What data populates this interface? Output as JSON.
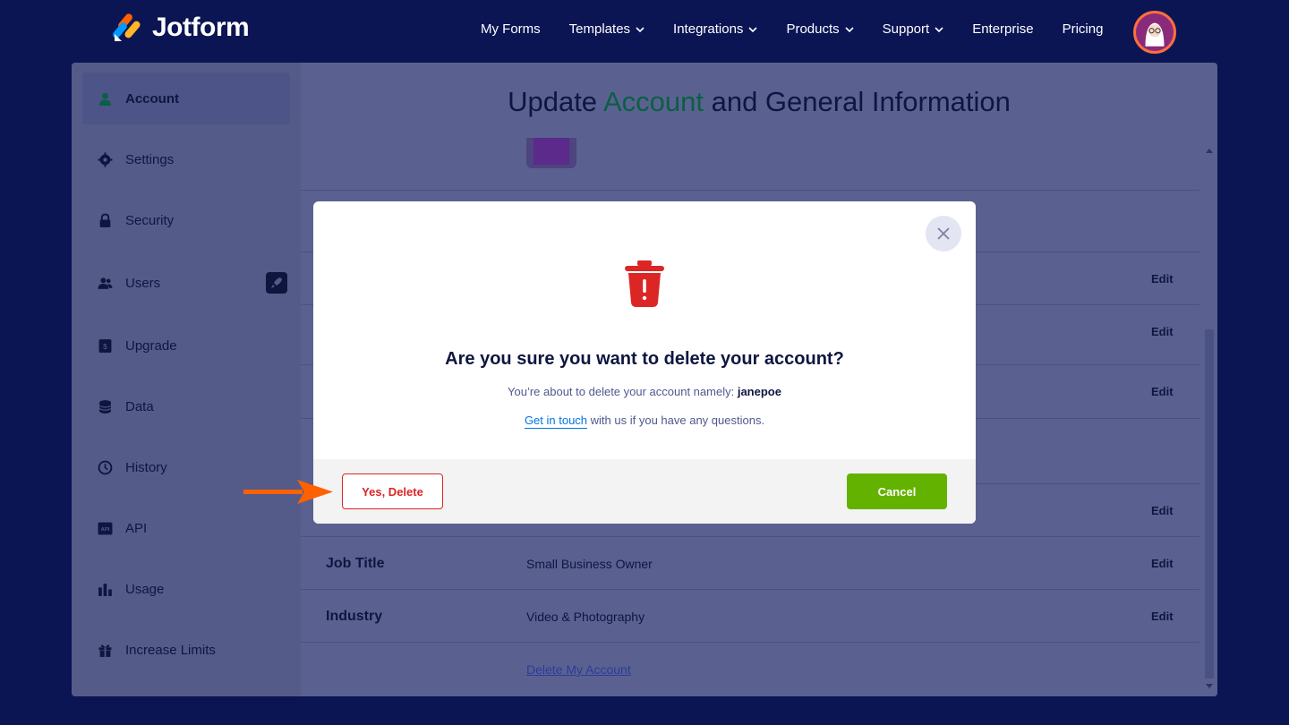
{
  "brand": {
    "name": "Jotform"
  },
  "nav": {
    "items": [
      {
        "label": "My Forms",
        "dropdown": false
      },
      {
        "label": "Templates",
        "dropdown": true
      },
      {
        "label": "Integrations",
        "dropdown": true
      },
      {
        "label": "Products",
        "dropdown": true
      },
      {
        "label": "Support",
        "dropdown": true
      },
      {
        "label": "Enterprise",
        "dropdown": false
      },
      {
        "label": "Pricing",
        "dropdown": false
      }
    ]
  },
  "sidebar": {
    "items": [
      {
        "label": "Account",
        "icon": "user-icon",
        "active": true
      },
      {
        "label": "Settings",
        "icon": "gear-icon"
      },
      {
        "label": "Security",
        "icon": "lock-icon"
      },
      {
        "label": "Users",
        "icon": "users-icon"
      },
      {
        "label": "Upgrade",
        "icon": "upgrade-icon"
      },
      {
        "label": "Data",
        "icon": "database-icon"
      },
      {
        "label": "History",
        "icon": "history-icon"
      },
      {
        "label": "API",
        "icon": "api-icon"
      },
      {
        "label": "Usage",
        "icon": "bar-chart-icon"
      },
      {
        "label": "Increase Limits",
        "icon": "gift-icon"
      }
    ]
  },
  "page": {
    "title_part1": "Update",
    "title_accent": "Account",
    "title_part2": "and General Information",
    "rows": [
      {
        "label": "",
        "value": "",
        "edit": "Edit"
      },
      {
        "label": "",
        "value": "",
        "edit": "Edit"
      },
      {
        "label": "",
        "value": "",
        "edit": "Edit"
      },
      {
        "label": "",
        "value": "",
        "edit": "Edit"
      },
      {
        "label": "Job Title",
        "value": "Small Business Owner",
        "edit": "Edit"
      },
      {
        "label": "Industry",
        "value": "Video & Photography",
        "edit": "Edit"
      }
    ],
    "delete_link": "Delete My Account"
  },
  "modal": {
    "title": "Are you sure you want to delete your account?",
    "desc_prefix": "You’re about to delete your account namely:",
    "username": "janepoe",
    "help_link": "Get in touch",
    "help_suffix": " with us if you have any questions.",
    "confirm_label": "Yes, Delete",
    "cancel_label": "Cancel"
  },
  "colors": {
    "background": "#0b1554",
    "danger": "#dc2626",
    "success": "#64b200",
    "annotation_arrow": "#ff6100"
  }
}
